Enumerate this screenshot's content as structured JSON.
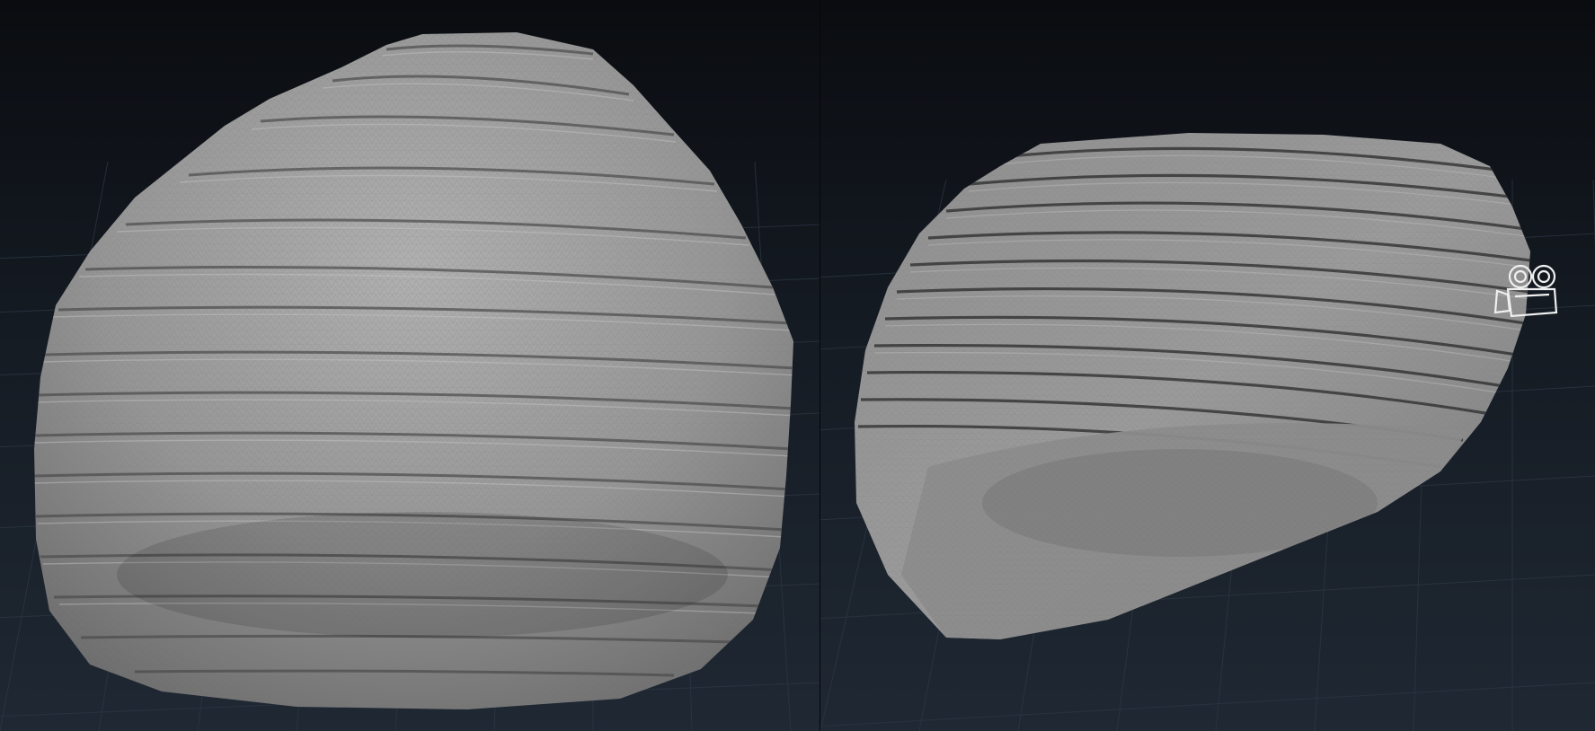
{
  "viewports": [
    {
      "name": "geometry-viewport-left"
    },
    {
      "name": "geometry-viewport-right"
    }
  ],
  "colors": {
    "background_top": "#0b0d11",
    "background_bottom": "#1c2530",
    "grid_minor": "#2b3542",
    "grid_major": "#3c4756",
    "rock_light": "#a7a7a7",
    "rock_mid": "#8e8e8e",
    "rock_dark": "#3a3a3a"
  },
  "icons": {
    "camera": "camera-icon"
  }
}
